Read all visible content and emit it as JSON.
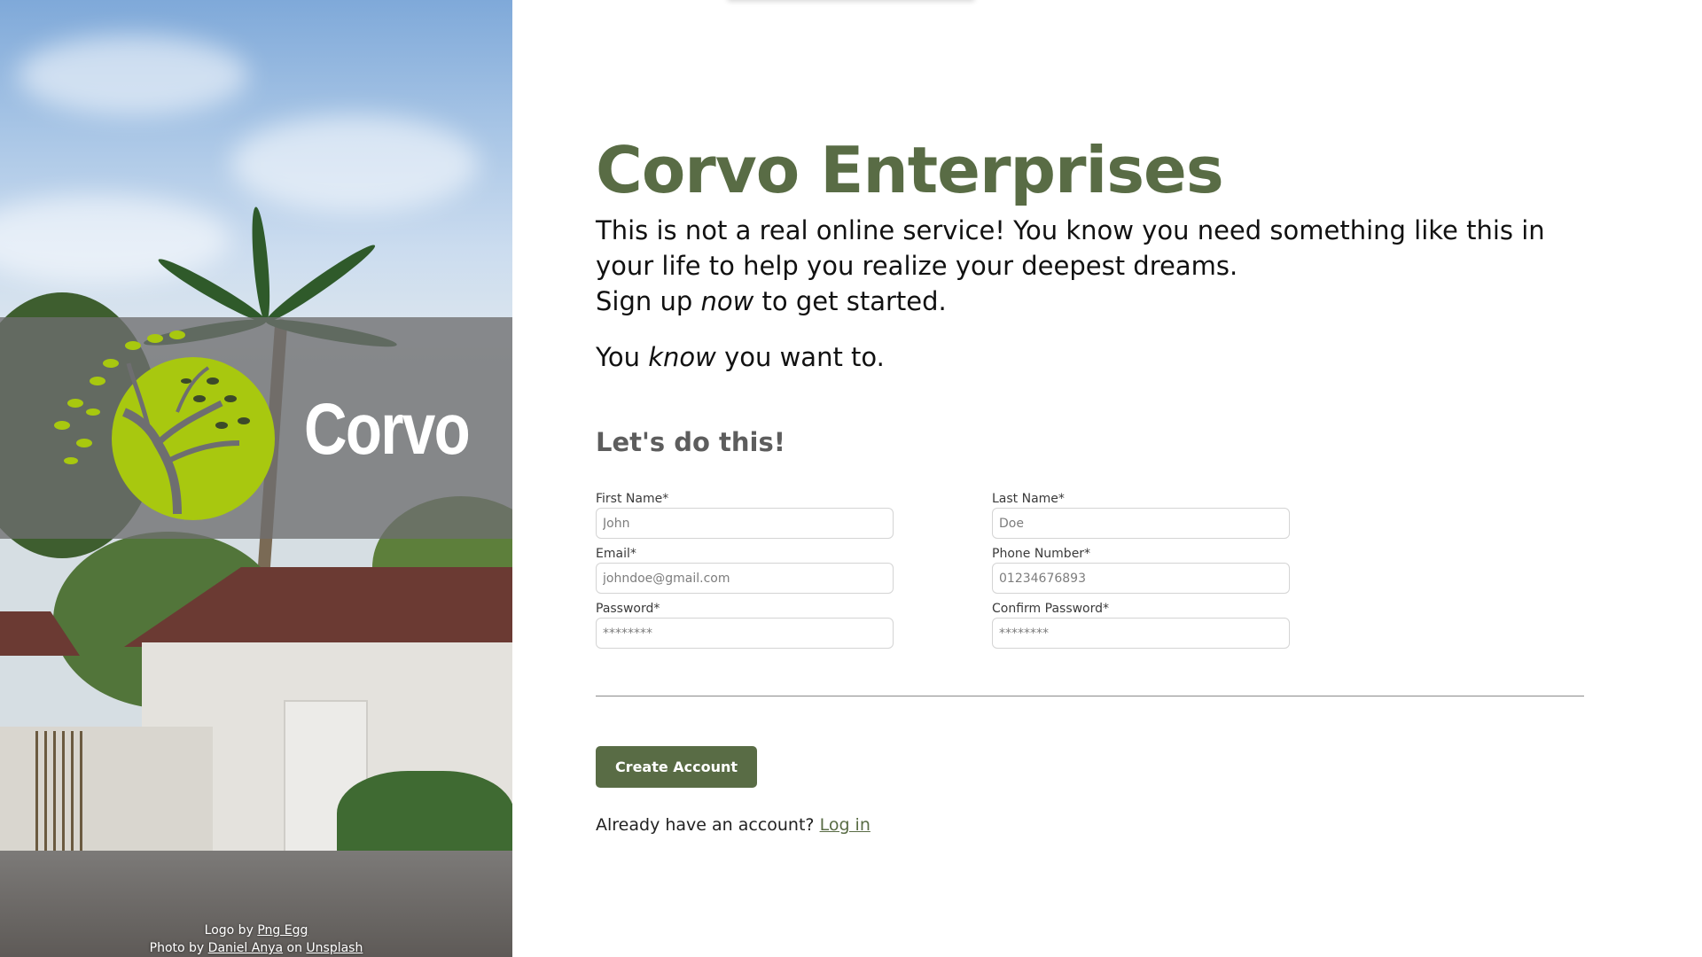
{
  "hero": {
    "logo_text": "Corvo",
    "credit_logo_prefix": "Logo by ",
    "credit_logo_link": "Png Egg",
    "credit_photo_prefix": "Photo by ",
    "credit_photo_author": "Daniel Anya",
    "credit_photo_on": " on ",
    "credit_photo_site": "Unsplash"
  },
  "main": {
    "title": "Corvo Enterprises",
    "intro_line1": "This is not a real online service! You know you need something like this in your life to help you realize your deepest dreams.",
    "intro_line2_start": "Sign up ",
    "intro_line2_em": "now",
    "intro_line2_end": " to get started.",
    "tagline_start": "You ",
    "tagline_em": "know",
    "tagline_end": " you want to."
  },
  "form": {
    "heading": "Let's do this!",
    "fields": [
      {
        "label": "First Name*",
        "placeholder": "John"
      },
      {
        "label": "Last Name*",
        "placeholder": "Doe"
      },
      {
        "label": "Email*",
        "placeholder": "johndoe@gmail.com"
      },
      {
        "label": "Phone Number*",
        "placeholder": "01234676893"
      },
      {
        "label": "Password*",
        "placeholder": "********"
      },
      {
        "label": "Confirm Password*",
        "placeholder": "********"
      }
    ],
    "submit_label": "Create Account",
    "login_prompt": "Already have an account? ",
    "login_link": "Log in"
  },
  "colors": {
    "brand": "#596c45",
    "logo_green": "#a8c80f",
    "heading_gray": "#5d5d5d"
  }
}
